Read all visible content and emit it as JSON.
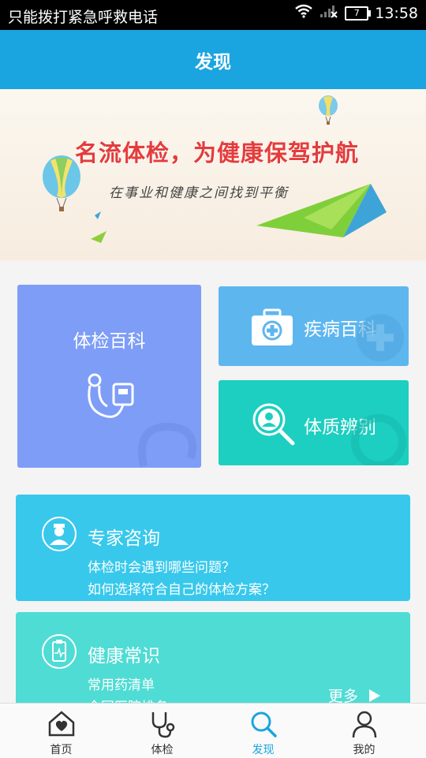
{
  "status_bar": {
    "carrier_text": "只能拨打紧急呼救电话",
    "battery_level": "7",
    "time": "13:58",
    "icons": [
      "wifi-icon",
      "signal-icon",
      "battery-icon"
    ]
  },
  "header": {
    "title": "发现"
  },
  "banner": {
    "headline": "名流体检，为健康保驾护航",
    "tagline": "在事业和健康之间找到平衡"
  },
  "tiles": {
    "checkup": {
      "label": "体检百科",
      "icon": "stethoscope-icon",
      "color": "#7d9df7"
    },
    "disease": {
      "label": "疾病百科",
      "icon": "first-aid-kit-icon",
      "color": "#5eb6ef"
    },
    "constitution": {
      "label": "体质辨别",
      "icon": "magnifier-person-icon",
      "color": "#1ccfc0"
    }
  },
  "cards": {
    "expert": {
      "title": "专家咨询",
      "lines": [
        "体检时会遇到哪些问题？",
        "如何选择符合自己的体检方案？"
      ],
      "icon": "doctor-icon",
      "color": "#38c8ec"
    },
    "health": {
      "title": "健康常识",
      "lines": [
        "常用药清单",
        "全国医院排名"
      ],
      "more_label": "更多",
      "icon": "clipboard-icon",
      "color": "#4fdcd4"
    }
  },
  "tabbar": {
    "items": [
      {
        "label": "首页",
        "icon": "home-heart-icon",
        "active": false
      },
      {
        "label": "体检",
        "icon": "stethoscope-icon",
        "active": false
      },
      {
        "label": "发现",
        "icon": "search-icon",
        "active": true
      },
      {
        "label": "我的",
        "icon": "person-icon",
        "active": false
      }
    ]
  },
  "colors": {
    "accent": "#1aa5e0",
    "banner_red": "#e43c3c"
  }
}
